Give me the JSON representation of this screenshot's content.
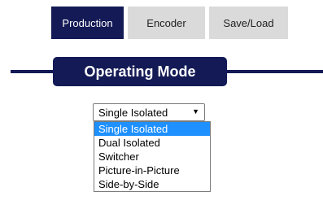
{
  "tabs": [
    {
      "label": "Production",
      "active": true
    },
    {
      "label": "Encoder",
      "active": false
    },
    {
      "label": "Save/Load",
      "active": false
    }
  ],
  "section": {
    "title": "Operating Mode"
  },
  "mode_select": {
    "value": "Single Isolated",
    "arrow_icon": "▼",
    "options": [
      "Single Isolated",
      "Dual Isolated",
      "Switcher",
      "Picture-in-Picture",
      "Side-by-Side"
    ],
    "selected_index": 0
  },
  "colors": {
    "accent": "#131a55",
    "tab_inactive": "#dadada",
    "highlight": "#1e90ff"
  }
}
